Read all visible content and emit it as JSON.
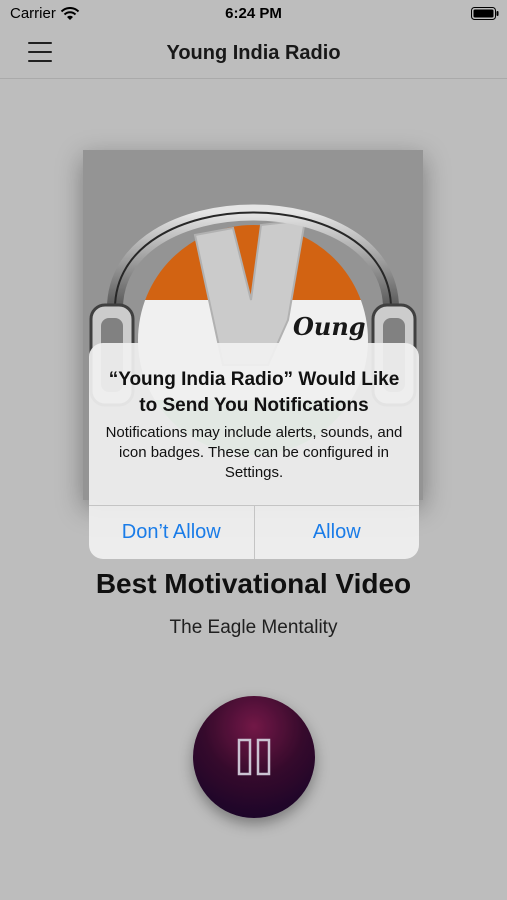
{
  "status": {
    "carrier": "Carrier",
    "time": "6:24 PM"
  },
  "nav": {
    "title": "Young India Radio"
  },
  "artwork": {
    "logo_text": "Oung"
  },
  "track": {
    "title": "Best Motivational Video",
    "subtitle": "The Eagle Mentality"
  },
  "alert": {
    "title": "“Young India Radio” Would Like to Send You Notifications",
    "message": "Notifications may include alerts, sounds, and icon badges. These can be configured in Settings.",
    "deny_label": "Don’t Allow",
    "allow_label": "Allow"
  },
  "icons": {
    "menu": "hamburger-menu-icon",
    "wifi": "wifi-icon",
    "battery": "battery-icon",
    "pause": "pause-icon"
  },
  "colors": {
    "accent": "#1a7ce8",
    "logo_orange": "#e06a14",
    "play_button_top": "#7a1a4c",
    "play_button_bottom": "#12042a"
  }
}
